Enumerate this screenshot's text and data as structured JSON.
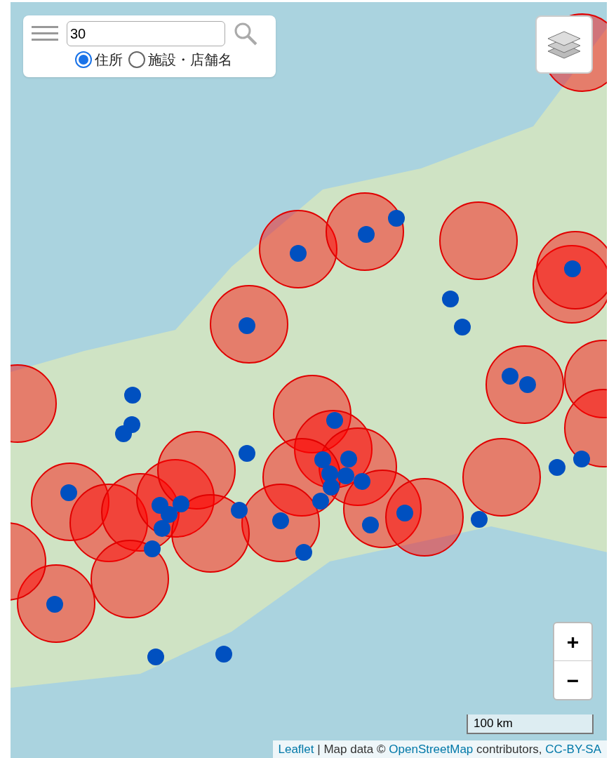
{
  "search": {
    "value": "30"
  },
  "search_modes": [
    {
      "label": "住所",
      "selected": true
    },
    {
      "label": "施設・店舗名",
      "selected": false
    }
  ],
  "zoom": {
    "in": "+",
    "out": "−"
  },
  "scale": "100 km",
  "attribution": [
    {
      "kind": "link",
      "text": "Leaflet"
    },
    {
      "kind": "text",
      "text": "| Map data ©"
    },
    {
      "kind": "link",
      "text": "OpenStreetMap"
    },
    {
      "kind": "text",
      "text": "contributors,"
    },
    {
      "kind": "link",
      "text": "CC-BY-SA"
    }
  ]
}
